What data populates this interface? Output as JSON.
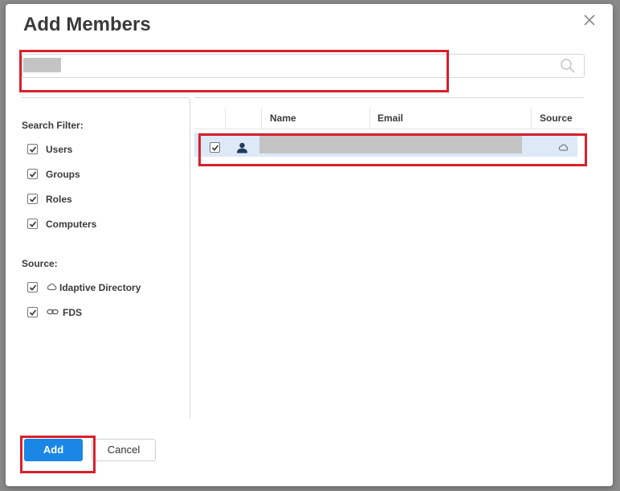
{
  "dialog": {
    "title": "Add Members",
    "close_icon": "close-icon"
  },
  "search": {
    "value": "",
    "placeholder": "",
    "icon": "search-icon"
  },
  "filters": {
    "search_filter_label": "Search Filter:",
    "items": [
      {
        "label": "Users",
        "checked": true
      },
      {
        "label": "Groups",
        "checked": true
      },
      {
        "label": "Roles",
        "checked": true
      },
      {
        "label": "Computers",
        "checked": true
      }
    ],
    "source_label": "Source:",
    "sources": [
      {
        "label": "Idaptive Directory",
        "icon": "cloud-icon",
        "checked": true
      },
      {
        "label": "FDS",
        "icon": "link-icon",
        "checked": true
      }
    ]
  },
  "table": {
    "columns": [
      "Name",
      "Email",
      "Source"
    ],
    "rows": [
      {
        "checked": true,
        "type_icon": "user-icon",
        "name": "",
        "email": "",
        "source_icon": "cloud-icon",
        "selected": true
      }
    ]
  },
  "buttons": {
    "add_label": "Add",
    "cancel_label": "Cancel"
  },
  "colors": {
    "accent": "#1a86e6",
    "highlight": "#d9202b",
    "selected_row": "#dde9f7"
  }
}
